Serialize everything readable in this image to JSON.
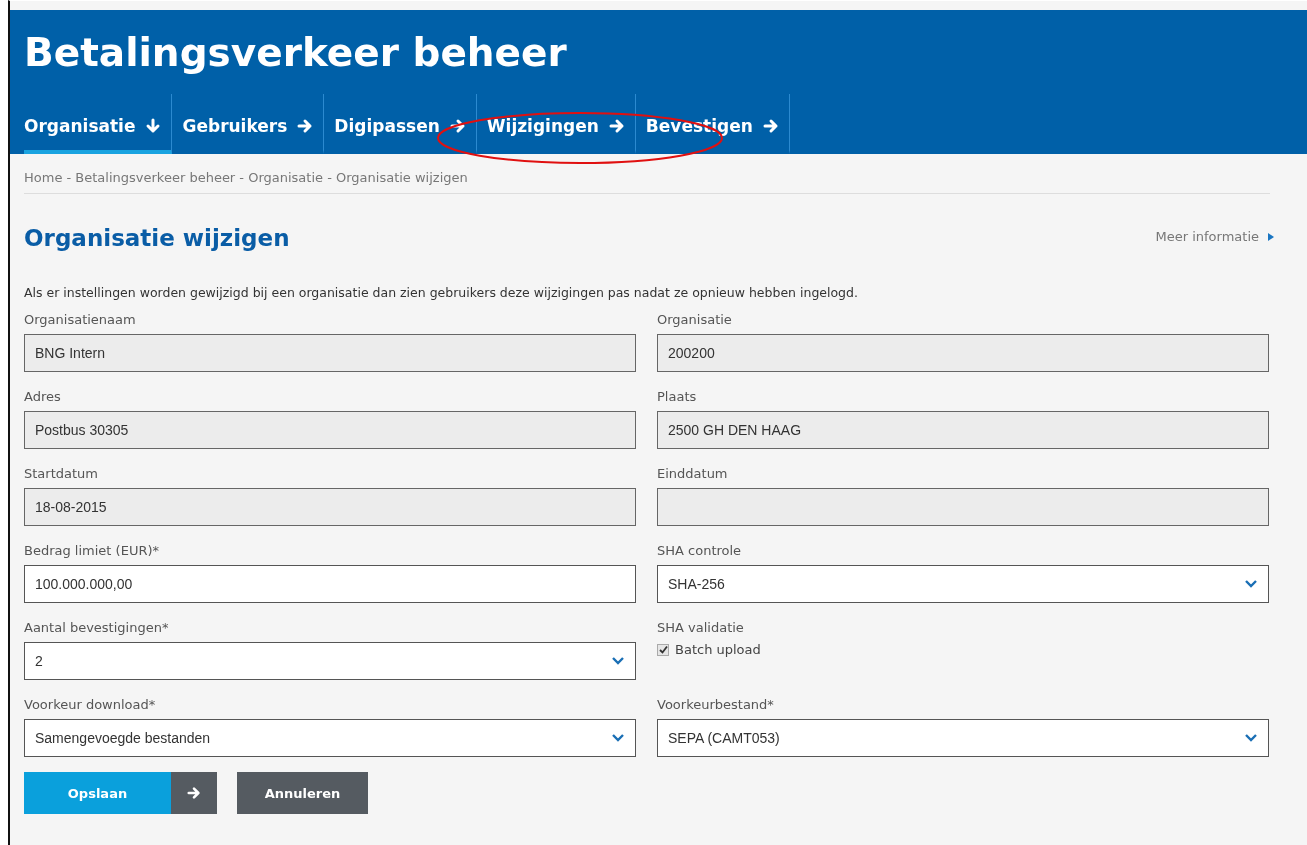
{
  "header": {
    "title": "Betalingsverkeer beheer"
  },
  "tabs": [
    {
      "label": "Organisatie",
      "selected": true
    },
    {
      "label": "Gebruikers",
      "selected": false
    },
    {
      "label": "Digipassen",
      "selected": false
    },
    {
      "label": "Wijzigingen",
      "selected": false
    },
    {
      "label": "Bevestigen",
      "selected": false
    }
  ],
  "breadcrumb": "Home - Betalingsverkeer beheer - Organisatie - Organisatie wijzigen",
  "page_title": "Organisatie wijzigen",
  "more_info": "Meer informatie",
  "intro": "Als er instellingen worden gewijzigd bij een organisatie dan zien gebruikers deze wijzigingen pas nadat ze opnieuw hebben ingelogd.",
  "fields": [
    {
      "label": "Organisatienaam",
      "kind": "readonly",
      "value": "BNG Intern"
    },
    {
      "label": "Organisatie",
      "kind": "readonly",
      "value": "200200"
    },
    {
      "label": "Adres",
      "kind": "readonly",
      "value": "Postbus 30305"
    },
    {
      "label": "Plaats",
      "kind": "readonly",
      "value": "2500 GH DEN HAAG"
    },
    {
      "label": "Startdatum",
      "kind": "readonly",
      "value": "18-08-2015"
    },
    {
      "label": "Einddatum",
      "kind": "readonly"
    },
    {
      "label": "Bedrag limiet (EUR)*",
      "kind": "input",
      "value": "100.000.000,00"
    },
    {
      "label": "SHA controle",
      "kind": "select",
      "value": "SHA-256"
    },
    {
      "label": "Aantal bevestigingen*",
      "kind": "select",
      "value": "2"
    },
    {
      "label": "SHA validatie",
      "kind": "checkbox",
      "option": "Batch upload",
      "checked": true
    },
    {
      "label": "Voorkeur download*",
      "kind": "select",
      "value": "Samengevoegde bestanden"
    },
    {
      "label": "Voorkeurbestand*",
      "kind": "select",
      "value": "SEPA (CAMT053)"
    }
  ],
  "buttons": {
    "save": "Opslaan",
    "cancel": "Annuleren"
  }
}
